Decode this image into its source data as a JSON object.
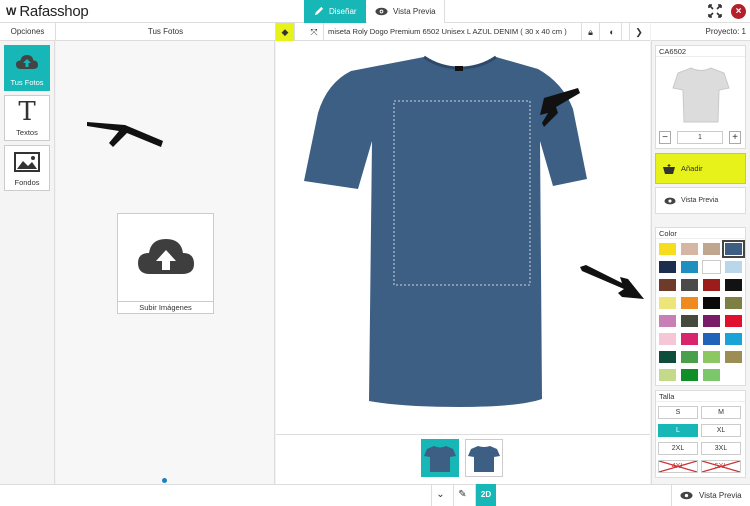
{
  "app": {
    "logo_mark": "W",
    "logo_text": "Rafasshop"
  },
  "top_tabs": {
    "design_label": "Diseñar",
    "preview_label": "Vista Previa"
  },
  "headers": {
    "options": "Opciones",
    "your_photos": "Tus Fotos",
    "project": "Proyecto: 1"
  },
  "tools": [
    {
      "label": "Tus Fotos",
      "icon": "cloud-upload-icon",
      "active": true
    },
    {
      "label": "Textos",
      "icon": "text-icon",
      "active": false
    },
    {
      "label": "Fondos",
      "icon": "image-icon",
      "active": false
    }
  ],
  "upload": {
    "label": "Subir Imágenes"
  },
  "product": {
    "title": "miseta Roly Dogo Premium 6502 Unisex L AZUL DENIM ( 30 x 40 cm )",
    "shirt_color": "#3d5f84"
  },
  "right": {
    "code": "CA6502",
    "quantity": "1",
    "add_label": "Añadir",
    "preview_label": "Vista Previa",
    "color_title": "Color",
    "size_title": "Talla",
    "sizes": [
      "S",
      "M",
      "L",
      "XL",
      "2XL",
      "3XL",
      "4XL",
      "5XL"
    ],
    "selected_size": "L",
    "colors": [
      "#f6dd1e",
      "#d5b6a5",
      "#c0a58f",
      "#3d5f84",
      "#1c2d4e",
      "#1f8fbf",
      "#ffffff",
      "#b9d6ea",
      "#6e3b2b",
      "#4a4a4a",
      "#9c1c1c",
      "#121212",
      "#ede47a",
      "#ef8a1f",
      "#0a0a0a",
      "#7d7f43",
      "#c77fb5",
      "#444b3c",
      "#7a1b6a",
      "#e0102f",
      "#f5c6d6",
      "#d8246c",
      "#1f64b8",
      "#1aa3d6",
      "#0d4d3a",
      "#4aa04a",
      "#8cc861",
      "#9b8d55",
      "#c4d98a",
      "#0e8f28",
      "#7cc66b"
    ]
  },
  "bottom": {
    "preview_label": "Vista Previa",
    "mode_2d": "2D"
  }
}
